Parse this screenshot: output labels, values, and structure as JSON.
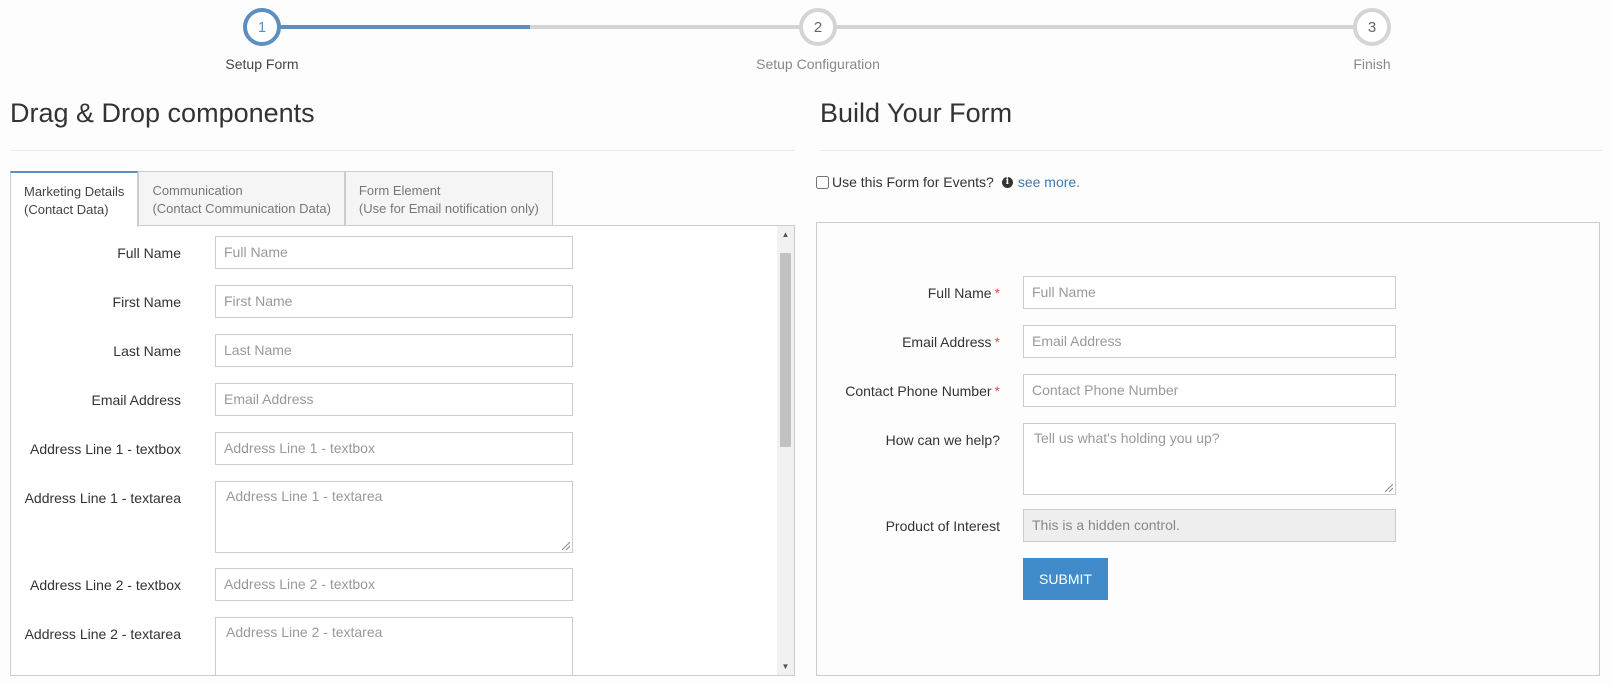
{
  "wizard": {
    "steps": [
      {
        "number": "1",
        "label": "Setup Form",
        "state": "active"
      },
      {
        "number": "2",
        "label": "Setup Configuration",
        "state": "pending"
      },
      {
        "number": "3",
        "label": "Finish",
        "state": "pending"
      }
    ],
    "accent_color": "#5a8fc0"
  },
  "left": {
    "title": "Drag & Drop components",
    "tabs": [
      {
        "line1": "Marketing Details",
        "line2": "(Contact Data)",
        "active": true
      },
      {
        "line1": "Communication",
        "line2": "(Contact Communication Data)",
        "active": false
      },
      {
        "line1": "Form Element",
        "line2": "(Use for Email notification only)",
        "active": false
      }
    ],
    "components": [
      {
        "label": "Full Name",
        "placeholder": "Full Name",
        "type": "textbox"
      },
      {
        "label": "First Name",
        "placeholder": "First Name",
        "type": "textbox"
      },
      {
        "label": "Last Name",
        "placeholder": "Last Name",
        "type": "textbox"
      },
      {
        "label": "Email Address",
        "placeholder": "Email Address",
        "type": "textbox"
      },
      {
        "label": "Address Line 1 - textbox",
        "placeholder": "Address Line 1 - textbox",
        "type": "textbox"
      },
      {
        "label": "Address Line 1 - textarea",
        "placeholder": "Address Line 1 - textarea",
        "type": "textarea"
      },
      {
        "label": "Address Line 2 - textbox",
        "placeholder": "Address Line 2 - textbox",
        "type": "textbox"
      },
      {
        "label": "Address Line 2 - textarea",
        "placeholder": "Address Line 2 - textarea",
        "type": "textarea"
      }
    ]
  },
  "right": {
    "title": "Build Your Form",
    "events_checkbox_label": "Use this Form for Events?",
    "info_icon": "info-circle-icon",
    "see_more": "see more.",
    "fields": [
      {
        "label": "Full Name",
        "required": true,
        "placeholder": "Full Name",
        "type": "textbox"
      },
      {
        "label": "Email Address",
        "required": true,
        "placeholder": "Email Address",
        "type": "textbox"
      },
      {
        "label": "Contact Phone Number",
        "required": true,
        "placeholder": "Contact Phone Number",
        "type": "textbox"
      },
      {
        "label": "How can we help?",
        "required": false,
        "placeholder": "Tell us what's holding you up?",
        "type": "textarea"
      },
      {
        "label": "Product of Interest",
        "required": false,
        "placeholder": "This is a hidden control.",
        "type": "hidden"
      }
    ],
    "required_marker": "*",
    "submit_label": "SUBMIT",
    "submit_color": "#428bca"
  }
}
